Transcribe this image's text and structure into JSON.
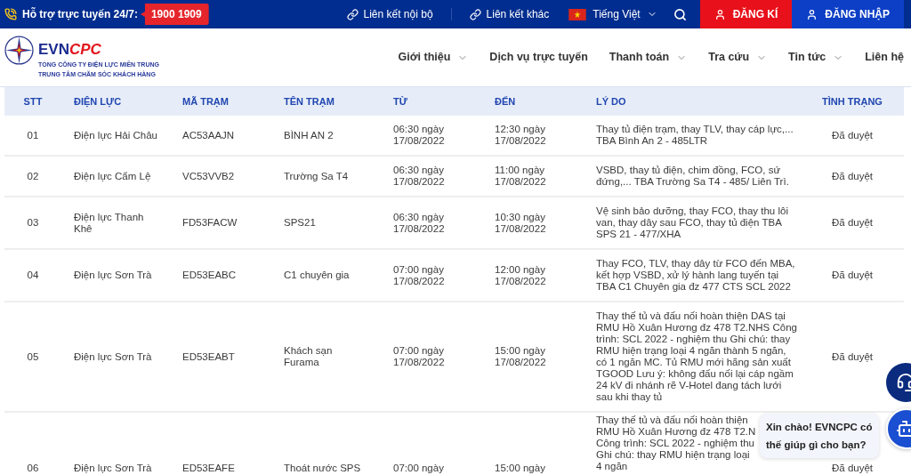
{
  "top_bar": {
    "support_label": "Hỗ trợ trực tuyến 24/7:",
    "hotline": "1900 1909",
    "links": [
      "Liên kết nội bộ",
      "Liên kết khác"
    ],
    "language": "Tiếng Việt",
    "buttons": [
      {
        "label": "ĐĂNG KÍ",
        "kind": "register"
      },
      {
        "label": "ĐĂNG NHẬP",
        "kind": "login"
      }
    ]
  },
  "header": {
    "brand": {
      "main": "EVN",
      "accent": "CPC"
    },
    "subtitle_lines": [
      "TỔNG CÔNG TY ĐIỆN LỰC MIỀN TRUNG",
      "TRUNG TÂM CHĂM SÓC KHÁCH HÀNG"
    ],
    "nav": [
      {
        "label": "Giới thiệu",
        "dropdown": true
      },
      {
        "label": "Dịch vụ trực tuyến",
        "dropdown": false
      },
      {
        "label": "Thanh toán",
        "dropdown": true
      },
      {
        "label": "Tra cứu",
        "dropdown": true
      },
      {
        "label": "Tin tức",
        "dropdown": true
      },
      {
        "label": "Liên hệ",
        "dropdown": false
      }
    ]
  },
  "table": {
    "columns": [
      "STT",
      "ĐIỆN LỰC",
      "MÃ TRẠM",
      "TÊN TRẠM",
      "TỪ",
      "ĐẾN",
      "LÝ DO",
      "TÌNH TRẠNG"
    ],
    "rows": [
      {
        "stt": "01",
        "dien_luc": "Điện lực Hải Châu",
        "ma_tram": "AC53AAJN",
        "ten_tram": "BÌNH AN 2",
        "tu": "06:30 ngày 17/08/2022",
        "den": "12:30 ngày 17/08/2022",
        "ly_do": "Thay tủ điện trạm, thay TLV, thay cáp lực,... TBA Bình An 2 - 485LTR",
        "tinh_trang": "Đã duyệt"
      },
      {
        "stt": "02",
        "dien_luc": "Điện lực Cẩm Lệ",
        "ma_tram": "VC53VVB2",
        "ten_tram": "Trường Sa T4",
        "tu": "06:30 ngày 17/08/2022",
        "den": "11:00 ngày 17/08/2022",
        "ly_do": "VSBD, thay tủ điện, chim đồng, FCO, sứ đứng,... TBA Trường Sa T4 - 485/ Liên Trì.",
        "tinh_trang": "Đã duyệt"
      },
      {
        "stt": "03",
        "dien_luc": "Điện lực Thanh Khê",
        "ma_tram": "FD53FACW",
        "ten_tram": "SPS21",
        "tu": "06:30 ngày 17/08/2022",
        "den": "10:30 ngày 17/08/2022",
        "ly_do": "Vệ sinh bảo dưỡng, thay FCO, thay thu lôi van, thay dây sau FCO, thay tủ điện TBA SPS 21 - 477/XHA",
        "tinh_trang": "Đã duyệt"
      },
      {
        "stt": "04",
        "dien_luc": "Điện lực Sơn Trà",
        "ma_tram": "ED53EABC",
        "ten_tram": "C1 chuyên gia",
        "tu": "07:00 ngày 17/08/2022",
        "den": "12:00 ngày 17/08/2022",
        "ly_do": "Thay FCO, TLV, thay dây từ FCO đến MBA, kết hợp VSBD, xử lý hành lang tuyến tại TBA C1 Chuyên gia đz 477 CTS SCL 2022",
        "tinh_trang": "Đã duyệt"
      },
      {
        "stt": "05",
        "dien_luc": "Điện lực Sơn Trà",
        "ma_tram": "ED53EABT",
        "ten_tram": "Khách sạn Furama",
        "tu": "07:00 ngày 17/08/2022",
        "den": "15:00 ngày 17/08/2022",
        "ly_do": "Thay thế tủ và đấu nối hoàn thiện DAS tại RMU Hồ Xuân Hương đz 478 T2.NHS Công trình: SCL 2022 - nghiệm thu Ghi chú: thay RMU hiện trạng loại 4 ngăn thành 5 ngăn, có 1 ngăn MC. Tủ RMU mới hãng sản xuất TGOOD Lưu ý: không đấu nối lại cáp ngầm 24 kV đi nhánh rẽ V-Hotel đang tách lưới sau khi thay tủ",
        "tinh_trang": "Đã duyệt"
      },
      {
        "stt": "06",
        "dien_luc": "Điện lực Sơn Trà",
        "ma_tram": "ED53EAFE",
        "ten_tram": "Thoát nước SPS",
        "tu": "07:00 ngày",
        "den": "15:00 ngày",
        "ly_do": "Thay thế tủ và đấu nối hoàn thiện RMU Hồ Xuân Hương đz 478 T2.N Công trình: SCL 2022 - nghiệm thu Ghi chú: thay RMU hiện trạng loại 4 ngăn",
        "tinh_trang": "Đã duyệt"
      }
    ]
  },
  "chat": {
    "greeting": "Xin chào! EVNCPC có thế giúp gì cho bạn?"
  }
}
